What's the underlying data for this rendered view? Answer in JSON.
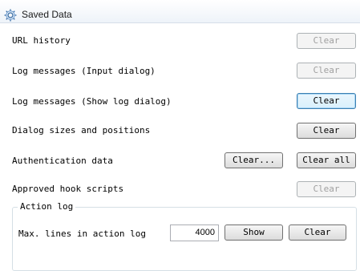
{
  "header": {
    "title": "Saved Data",
    "icon": "gear-icon"
  },
  "rows": {
    "url_history": {
      "label": "URL history",
      "button": "Clear"
    },
    "log_input": {
      "label": "Log messages (Input dialog)",
      "button": "Clear"
    },
    "log_show": {
      "label": "Log messages (Show log dialog)",
      "button": "Clear"
    },
    "dialog_sizes": {
      "label": "Dialog sizes and positions",
      "button": "Clear"
    },
    "auth": {
      "label": "Authentication data",
      "button_clear": "Clear...",
      "button_clear_all": "Clear all"
    },
    "hook_scripts": {
      "label": "Approved hook scripts",
      "button": "Clear"
    }
  },
  "action_log": {
    "legend": "Action log",
    "max_lines_label": "Max. lines in action log",
    "max_lines_value": "4000",
    "show_button": "Show",
    "clear_button": "Clear"
  },
  "colors": {
    "focus_border": "#3c7fb1",
    "disabled_text": "#a0a0a0",
    "header_bg": "#eef3f9"
  }
}
